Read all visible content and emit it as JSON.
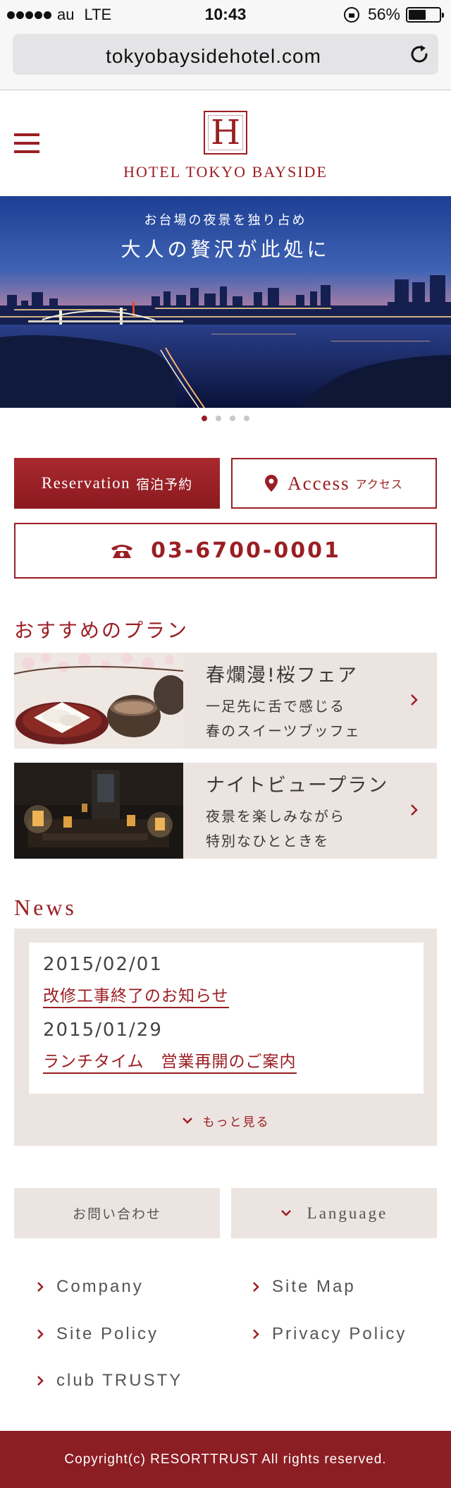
{
  "status_bar": {
    "carrier": "au",
    "network": "LTE",
    "time": "10:43",
    "battery": "56%"
  },
  "browser": {
    "url": "tokyobaysidehotel.com"
  },
  "header": {
    "logo_letter": "H",
    "logo_name": "HOTEL TOKYO BAYSIDE"
  },
  "hero": {
    "subtitle": "お台場の夜景を独り占め",
    "title": "大人の贅沢が此処に",
    "slide_count": 4,
    "active_slide": 1
  },
  "actions": {
    "reservation_en": "Reservation",
    "reservation_jp": "宿泊予約",
    "access_en": "Access",
    "access_jp": "アクセス",
    "phone": "03-6700-0001"
  },
  "plans": {
    "title": "おすすめのプラン",
    "items": [
      {
        "name": "春爛漫!桜フェア",
        "desc1": "一足先に舌で感じる",
        "desc2": "春のスイーツブッフェ"
      },
      {
        "name": "ナイトビュープラン",
        "desc1": "夜景を楽しみながら",
        "desc2": "特別なひとときを"
      }
    ]
  },
  "news": {
    "title": "News",
    "items": [
      {
        "date": "2015/02/01",
        "text": "改修工事終了のお知らせ"
      },
      {
        "date": "2015/01/29",
        "text": "ランチタイム　営業再開のご案内"
      }
    ],
    "more": "もっと見る"
  },
  "footer": {
    "contact": "お問い合わせ",
    "language": "Language",
    "links": [
      "Company",
      "Site Map",
      "Site Policy",
      "Privacy Policy",
      "club TRUSTY"
    ],
    "copyright": "Copyright(c) RESORTTRUST All rights reserved."
  },
  "colors": {
    "brand": "#9a1e23",
    "panel": "#ece4e0",
    "footer_bg": "#8b1e23"
  }
}
